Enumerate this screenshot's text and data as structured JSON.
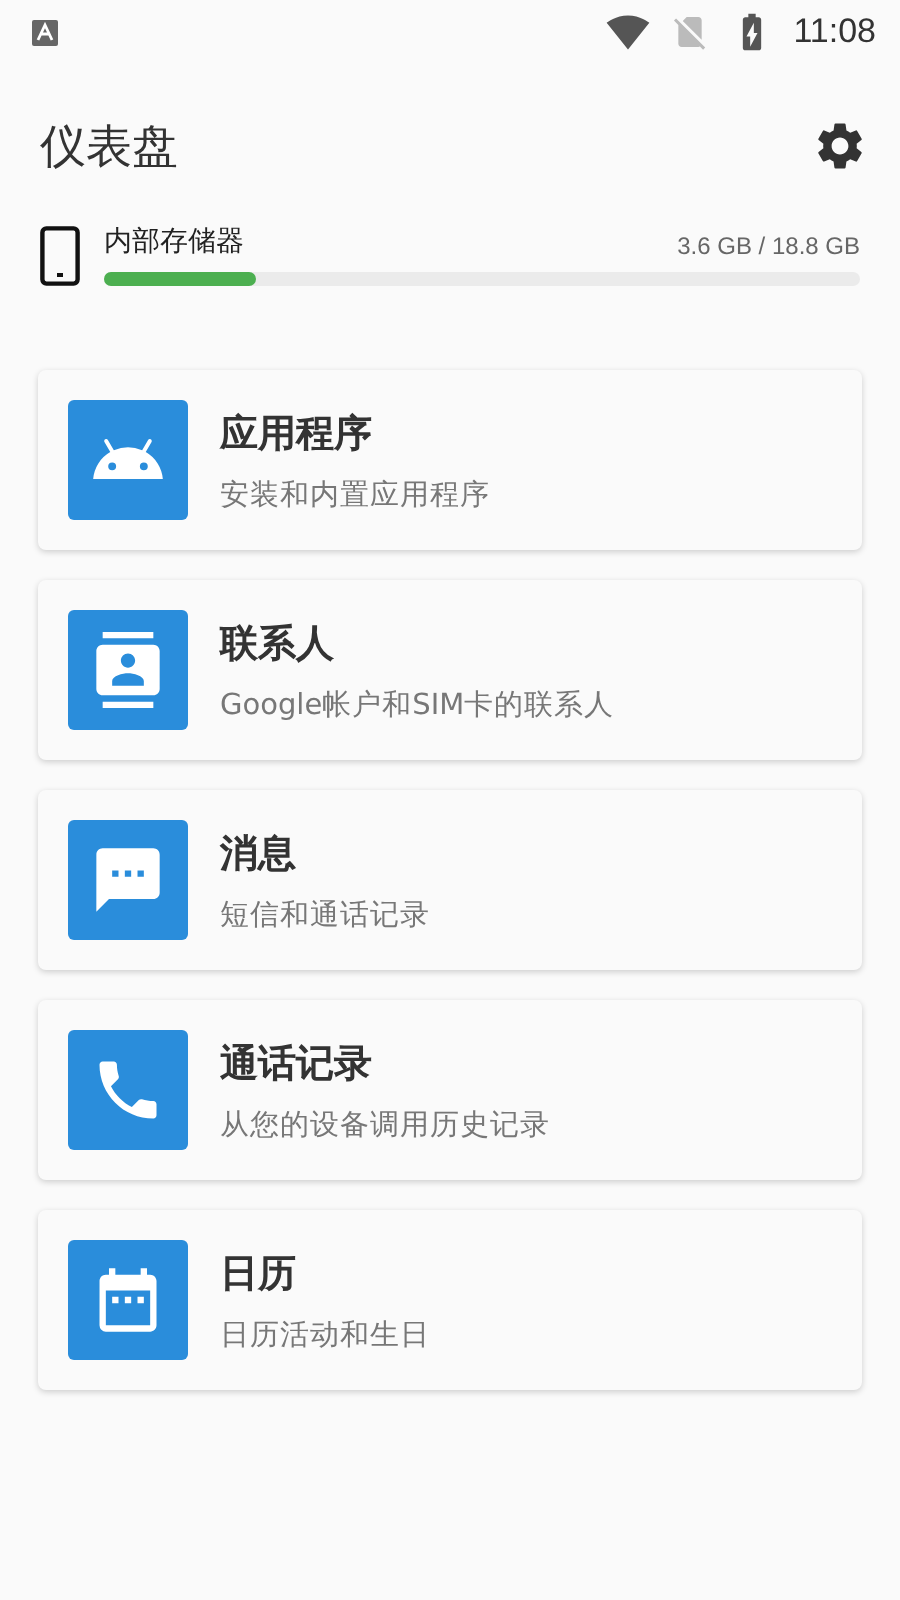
{
  "status_bar": {
    "time": "11:08"
  },
  "header": {
    "title": "仪表盘"
  },
  "storage": {
    "label": "内部存储器",
    "reading": "3.6 GB / 18.8 GB",
    "level": 0.2
  },
  "cards": [
    {
      "kind": "apps",
      "title": "应用程序",
      "subtitle": "安装和内置应用程序"
    },
    {
      "kind": "contacts",
      "title": "联系人",
      "subtitle": "Google帐户和SIM卡的联系人"
    },
    {
      "kind": "messages",
      "title": "消息",
      "subtitle": "短信和通话记录"
    },
    {
      "kind": "calls",
      "title": "通话记录",
      "subtitle": "从您的设备调用历史记录"
    },
    {
      "kind": "calendar",
      "title": "日历",
      "subtitle": "日历活动和生日"
    }
  ]
}
